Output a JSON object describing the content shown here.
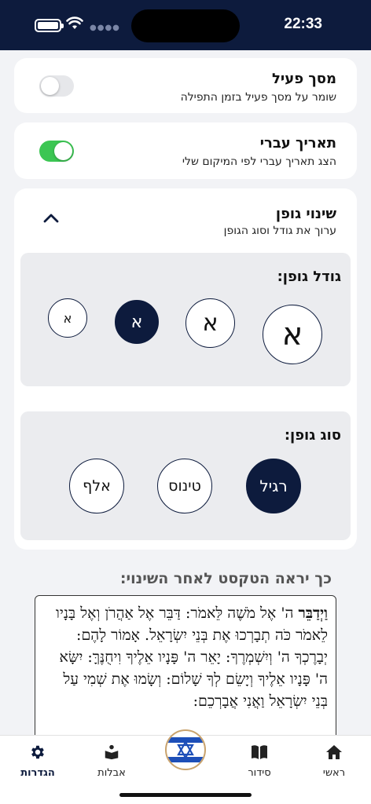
{
  "status_bar": {
    "time": "22:33"
  },
  "settings": {
    "active_screen": {
      "title": "מסך פעיל",
      "subtitle": "שומר על מסך פעיל בזמן התפילה",
      "enabled": false
    },
    "hebrew_date": {
      "title": "תאריך עברי",
      "subtitle": "הצג תאריך עברי לפי המיקום שלי",
      "enabled": true
    },
    "font_change": {
      "title": "שינוי גופן",
      "subtitle": "ערוך את גודל וסוג הגופן",
      "size_label": "גודל גופן:",
      "sizes": [
        {
          "glyph": "א",
          "selected": false
        },
        {
          "glyph": "א",
          "selected": false
        },
        {
          "glyph": "א",
          "selected": true
        },
        {
          "glyph": "א",
          "selected": false
        }
      ],
      "type_label": "סוג גופן:",
      "types": [
        {
          "label": "רגיל",
          "selected": true
        },
        {
          "label": "טינוס",
          "selected": false
        },
        {
          "label": "אלף",
          "selected": false
        }
      ]
    },
    "preview": {
      "label": "כך יראה הטקסט לאחר השינוי:",
      "first_word": "וַיְדַבֵּר",
      "text": " ה' אֶל מֹשֶׁה לֵּאמֹר: דַּבֵּר אֶל אַהֲרֹן וְאֶל בָּנָיו לֵאמֹר כֹּה תְבָרְכוּ אֶת בְּנֵי יִשְׂרָאֵל. אָמוֹר לָהֶם: יְבָרֶכְךָ ה' וְיִשְׁמְרֶךָ: יָאֵר ה' פָּנָיו אֵלֶיךָ וִיחֻנֶּךָּ: יִשָּׂא ה' פָּנָיו אֵלֶיךָ וְיָשֵׂם לְךָ שָׁלוֹם: וְשָׂמוּ אֶת שְׁמִי עַל בְּנֵי יִשְׂרָאֵל וַאֲנִי אֲבָרְכֵם:"
    }
  },
  "tabs": [
    {
      "label": "ראשי",
      "icon": "home-icon"
    },
    {
      "label": "סידור",
      "icon": "book-icon"
    },
    {
      "label": "",
      "icon": "israel-flag-icon"
    },
    {
      "label": "אבלות",
      "icon": "mourning-icon"
    },
    {
      "label": "הגדרות",
      "icon": "gear-icon",
      "active": true
    }
  ],
  "colors": {
    "navy": "#0d1b3d",
    "toggle_on": "#3cc653",
    "toggle_off": "#e6e7ea"
  }
}
